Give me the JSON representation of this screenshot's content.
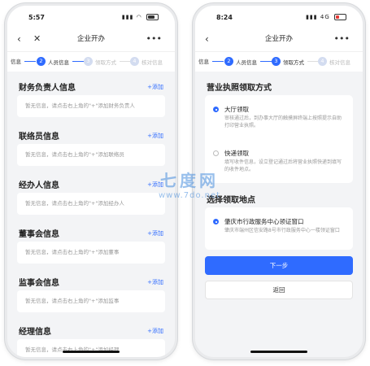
{
  "left_phone": {
    "status": {
      "time": "5:57"
    },
    "nav": {
      "back_icon": "chevron-left-icon",
      "close_icon": "close-icon",
      "title": "企业开办",
      "more_icon": "ellipsis-icon"
    },
    "steps": [
      {
        "label": "信息",
        "state": "done"
      },
      {
        "num": "2",
        "label": "人员信息",
        "state": "active"
      },
      {
        "num": "3",
        "label": "领取方式",
        "state": "inactive"
      },
      {
        "num": "4",
        "label": "核对信息",
        "state": "inactive"
      }
    ],
    "sections": [
      {
        "title": "财务负责人信息",
        "add": "+添加",
        "hint": "暂无信息，请点击右上角的\"+\"添加财务负责人"
      },
      {
        "title": "联络员信息",
        "add": "+添加",
        "hint": "暂无信息，请点击右上角的\"+\"添加联络员"
      },
      {
        "title": "经办人信息",
        "add": "+添加",
        "hint": "暂无信息，请点击右上角的\"+\"添加经办人"
      },
      {
        "title": "董事会信息",
        "add": "+添加",
        "hint": "暂无信息，请点击右上角的\"+\"添加董事"
      },
      {
        "title": "监事会信息",
        "add": "+添加",
        "hint": "暂无信息，请点击右上角的\"+\"添加监事"
      },
      {
        "title": "经理信息",
        "add": "+添加",
        "hint": "暂无信息，请点击右上角的\"+\"添加经理"
      }
    ]
  },
  "right_phone": {
    "status": {
      "time": "8:24",
      "network": "4G"
    },
    "nav": {
      "back_icon": "chevron-left-icon",
      "title": "企业开办",
      "more_icon": "ellipsis-icon"
    },
    "steps": [
      {
        "label": "信息",
        "state": "done"
      },
      {
        "num": "2",
        "label": "人员信息",
        "state": "done"
      },
      {
        "num": "3",
        "label": "领取方式",
        "state": "active"
      },
      {
        "num": "4",
        "label": "核对信息",
        "state": "inactive"
      }
    ],
    "license_title": "营业执照领取方式",
    "options": [
      {
        "title": "大厅领取",
        "desc": "审核通过后，到办事大厅的触摸屏终端上按照提示自助打印营业执照。",
        "selected": true
      },
      {
        "title": "快递领取",
        "desc": "填写收件信息，设立登记通过后将营业执照快递到填写的收件地点。",
        "selected": false
      }
    ],
    "location_title": "选择领取地点",
    "location": {
      "title": "肇庆市行政服务中心领证窗口",
      "desc": "肇庆市端州区信安路8号市行政服务中心一楼领证窗口",
      "selected": true
    },
    "next_button": "下一步",
    "back_button": "返回"
  },
  "watermark": {
    "logo": "七度网",
    "url": "www.7do.net"
  },
  "colors": {
    "accent": "#2f6bff",
    "background": "#f3f4f6",
    "hint_text": "#999999"
  }
}
